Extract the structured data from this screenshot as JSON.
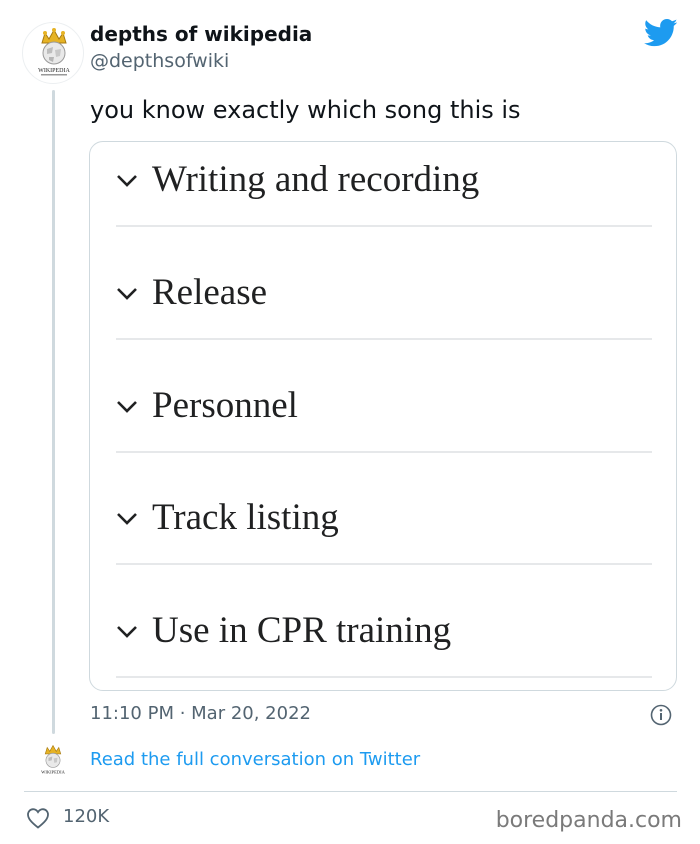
{
  "author": {
    "name": "depths of wikipedia",
    "handle": "@depthsofwiki",
    "avatar_caption": "Wikipedia"
  },
  "tweet": {
    "text": "you know exactly which song this is",
    "timestamp": "11:10 PM · Mar 20, 2022"
  },
  "card": {
    "sections": [
      {
        "label": "Writing and recording"
      },
      {
        "label": "Release"
      },
      {
        "label": "Personnel"
      },
      {
        "label": "Track listing"
      },
      {
        "label": "Use in CPR training"
      }
    ]
  },
  "footer": {
    "read_link": "Read the full conversation on Twitter",
    "likes": "120K",
    "watermark": "boredpanda.com"
  },
  "colors": {
    "twitter_blue": "#1d9bf0",
    "secondary_text": "#536471",
    "border": "#cfd9de"
  },
  "icons": [
    "wikipedia-logo-icon",
    "twitter-bird-icon",
    "chevron-down-icon",
    "info-icon",
    "heart-icon"
  ]
}
